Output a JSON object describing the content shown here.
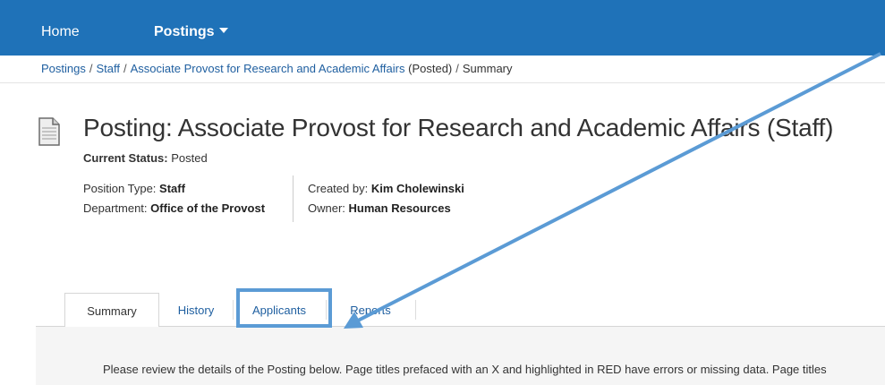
{
  "nav": {
    "home": "Home",
    "postings": "Postings"
  },
  "breadcrumb": {
    "item1": "Postings",
    "item2": "Staff",
    "item3": "Associate Provost for Research and Academic Affairs",
    "item3_suffix": "(Posted)",
    "current": "Summary",
    "sep": "/"
  },
  "header": {
    "title": "Posting: Associate Provost for Research and Academic Affairs (Staff)",
    "status_label": "Current Status:",
    "status_value": "Posted"
  },
  "meta": {
    "position_type_label": "Position Type:",
    "position_type_value": "Staff",
    "department_label": "Department:",
    "department_value": "Office of the Provost",
    "created_by_label": "Created by:",
    "created_by_value": "Kim Cholewinski",
    "owner_label": "Owner:",
    "owner_value": "Human Resources"
  },
  "tabs": [
    {
      "label": "Summary"
    },
    {
      "label": "History"
    },
    {
      "label": "Applicants"
    },
    {
      "label": "Reports"
    }
  ],
  "panel": {
    "text": "Please review the details of the Posting below.  Page titles prefaced with an X and highlighted in RED have errors or missing data.  Page titles"
  },
  "annotation": {
    "color": "#5b9bd5"
  },
  "colors": {
    "nav_bg": "#1f72b8",
    "link": "#1f5fa0"
  }
}
